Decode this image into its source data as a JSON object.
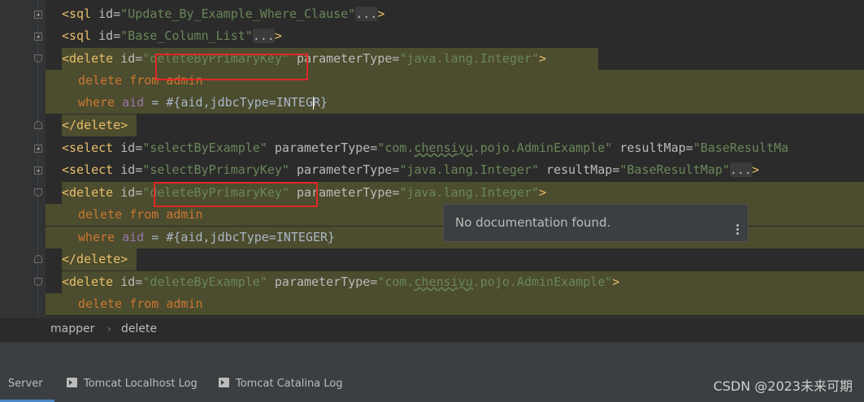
{
  "editor": {
    "line1": {
      "tag": "<sql ",
      "attr": "id=",
      "val": "\"Update_By_Example_Where_Clause\"",
      "fold": "...",
      "end": ">"
    },
    "line2": {
      "tag": "<sql ",
      "attr": "id=",
      "val": "\"Base_Column_List\"",
      "fold": "...",
      "end": ">"
    },
    "line3": {
      "tag": "<delete ",
      "attr": "id=",
      "val": "\"deleteByPrimaryKey\"",
      "attr2": " parameterType=",
      "val2": "\"java.lang.Integer\"",
      "end": ">"
    },
    "line4": {
      "kw1": "delete ",
      "kw2": "from ",
      "kw3": "admin"
    },
    "line5": {
      "kw": "where ",
      "col": "aid",
      "text1": " = #{aid,jdbcType=INTEG",
      "text2": "R}"
    },
    "line6": {
      "tag": "</delete>"
    },
    "line7": {
      "tag": "<select ",
      "attr": "id=",
      "val": "\"selectByExample\"",
      "attr2": " parameterType=",
      "val2a": "\"com.",
      "val2u": "chensiyu",
      "val2b": ".pojo.AdminExample\"",
      "attr3": " resultMap=",
      "val3": "\"BaseResultMa"
    },
    "line8": {
      "tag": "<select ",
      "attr": "id=",
      "val": "\"selectByPrimaryKey\"",
      "attr2": " parameterType=",
      "val2": "\"java.lang.Integer\"",
      "attr3": " resultMap=",
      "val3": "\"BaseResultMap\"",
      "fold": "...",
      "end": ">"
    },
    "line9": {
      "tag": "<delete ",
      "attr": "id=",
      "val": "\"deleteByPrimaryKey\"",
      "attr2": " parameterType=",
      "val2": "\"java.lang.Integer\"",
      "end": ">"
    },
    "line10": {
      "kw1": "delete ",
      "kw2": "from ",
      "kw3": "admin"
    },
    "line11": {
      "kw": "where ",
      "col": "aid",
      "text": " = #{aid,jdbcType=INTEGER}"
    },
    "line12": {
      "tag": "</delete>"
    },
    "line13": {
      "tag": "<delete ",
      "attr": "id=",
      "val": "\"deleteByExample\"",
      "attr2": " parameterType=",
      "val2a": "\"com.",
      "val2u": "chensiyu",
      "val2b": ".pojo.AdminExample\"",
      "end": ">"
    },
    "line14": {
      "kw1": "delete ",
      "kw2": "from ",
      "kw3": "admin"
    }
  },
  "popup": {
    "text": "No documentation found."
  },
  "breadcrumb": {
    "items": [
      "mapper",
      "delete"
    ],
    "separator": "›"
  },
  "statusbar": {
    "tabs": [
      {
        "label": "Server",
        "active": true
      },
      {
        "label": "Tomcat Localhost Log"
      },
      {
        "label": "Tomcat Catalina Log"
      }
    ]
  },
  "watermark": "CSDN @2023未来可期",
  "colors": {
    "background": "#2b2b2b",
    "tag": "#e8bf6a",
    "string": "#6a8759",
    "keyword": "#cc7832",
    "highlight": "#4c4c2e",
    "annotation_box": "#e02727"
  }
}
